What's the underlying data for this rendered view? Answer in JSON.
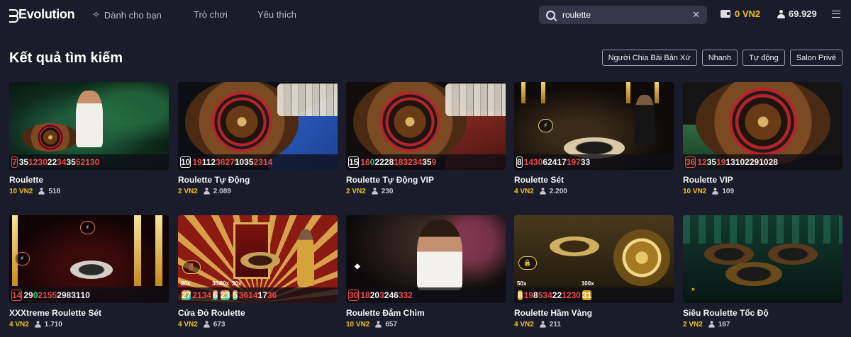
{
  "header": {
    "brand": "Evolution",
    "nav": [
      {
        "label": "Dành cho bạn"
      },
      {
        "label": "Trò chơi"
      },
      {
        "label": "Yêu thích"
      }
    ],
    "search": {
      "value": "roulette",
      "placeholder": ""
    },
    "balance": "0 VN2",
    "players": "69.929"
  },
  "page": {
    "title": "Kết quả tìm kiếm",
    "filters": [
      "Người Chia Bài Bản Xứ",
      "Nhanh",
      "Tự động",
      "Salon Privé"
    ]
  },
  "colors": {
    "accent": "#f2c21d",
    "red": "#f04848",
    "green": "#2fc86a",
    "background": "#1b1c2b"
  },
  "games": [
    {
      "name": "Roulette",
      "stake": "10 VN2",
      "players": "518",
      "results": [
        {
          "v": "7",
          "c": "red"
        },
        {
          "v": "35",
          "c": "black"
        },
        {
          "v": "12",
          "c": "red"
        },
        {
          "v": "30",
          "c": "red"
        },
        {
          "v": "22",
          "c": "black"
        },
        {
          "v": "34",
          "c": "red"
        },
        {
          "v": "35",
          "c": "black"
        },
        {
          "v": "5",
          "c": "red"
        },
        {
          "v": "21",
          "c": "red"
        },
        {
          "v": "30",
          "c": "red"
        }
      ]
    },
    {
      "name": "Roulette Tự Động",
      "stake": "2 VN2",
      "players": "2.089",
      "results": [
        {
          "v": "10",
          "c": "black"
        },
        {
          "v": "19",
          "c": "red"
        },
        {
          "v": "11",
          "c": "black"
        },
        {
          "v": "2",
          "c": "black"
        },
        {
          "v": "36",
          "c": "red"
        },
        {
          "v": "27",
          "c": "red"
        },
        {
          "v": "10",
          "c": "black"
        },
        {
          "v": "35",
          "c": "black"
        },
        {
          "v": "23",
          "c": "red"
        },
        {
          "v": "14",
          "c": "red"
        }
      ]
    },
    {
      "name": "Roulette Tự Động VIP",
      "stake": "2 VN2",
      "players": "230",
      "results": [
        {
          "v": "15",
          "c": "black"
        },
        {
          "v": "16",
          "c": "red"
        },
        {
          "v": "0",
          "c": "green"
        },
        {
          "v": "22",
          "c": "black"
        },
        {
          "v": "28",
          "c": "black"
        },
        {
          "v": "18",
          "c": "red"
        },
        {
          "v": "32",
          "c": "red"
        },
        {
          "v": "34",
          "c": "red"
        },
        {
          "v": "35",
          "c": "black"
        },
        {
          "v": "9",
          "c": "red"
        }
      ]
    },
    {
      "name": "Roulette Sét",
      "stake": "4 VN2",
      "players": "2.200",
      "results": [
        {
          "v": "8",
          "c": "black"
        },
        {
          "v": "14",
          "c": "red"
        },
        {
          "v": "30",
          "c": "red"
        },
        {
          "v": "6",
          "c": "black"
        },
        {
          "v": "24",
          "c": "black"
        },
        {
          "v": "17",
          "c": "black"
        },
        {
          "v": "19",
          "c": "red"
        },
        {
          "v": "7",
          "c": "red"
        },
        {
          "v": "33",
          "c": "black"
        }
      ]
    },
    {
      "name": "Roulette VIP",
      "stake": "10 VN2",
      "players": "109",
      "results": [
        {
          "v": "36",
          "c": "red"
        },
        {
          "v": "12",
          "c": "red"
        },
        {
          "v": "35",
          "c": "black"
        },
        {
          "v": "19",
          "c": "red"
        },
        {
          "v": "13",
          "c": "black"
        },
        {
          "v": "10",
          "c": "black"
        },
        {
          "v": "2",
          "c": "black"
        },
        {
          "v": "29",
          "c": "black"
        },
        {
          "v": "10",
          "c": "black"
        },
        {
          "v": "28",
          "c": "black"
        }
      ]
    },
    {
      "name": "XXXtreme Roulette Sét",
      "stake": "4 VN2",
      "players": "1.710",
      "results": [
        {
          "v": "14",
          "c": "red"
        },
        {
          "v": "29",
          "c": "black"
        },
        {
          "v": "0",
          "c": "green"
        },
        {
          "v": "21",
          "c": "red"
        },
        {
          "v": "5",
          "c": "red"
        },
        {
          "v": "5",
          "c": "red"
        },
        {
          "v": "29",
          "c": "black"
        },
        {
          "v": "8",
          "c": "black"
        },
        {
          "v": "31",
          "c": "black"
        },
        {
          "v": "10",
          "c": "black"
        }
      ]
    },
    {
      "name": "Cửa Đỏ Roulette",
      "stake": "4 VN2",
      "players": "673",
      "results": [
        {
          "v": "27",
          "c": "boxed",
          "tag": "20x"
        },
        {
          "v": "21",
          "c": "red"
        },
        {
          "v": "34",
          "c": "red"
        },
        {
          "v": "6",
          "c": "boxed",
          "tag": "30x"
        },
        {
          "v": "23",
          "c": "boxed",
          "tag": "30x"
        },
        {
          "v": "5",
          "c": "boxed",
          "tag": "30x"
        },
        {
          "v": "36",
          "c": "red"
        },
        {
          "v": "14",
          "c": "red"
        },
        {
          "v": "17",
          "c": "black"
        },
        {
          "v": "36",
          "c": "red"
        }
      ]
    },
    {
      "name": "Roulette Đắm Chìm",
      "stake": "10 VN2",
      "players": "657",
      "results": [
        {
          "v": "30",
          "c": "red"
        },
        {
          "v": "18",
          "c": "red"
        },
        {
          "v": "20",
          "c": "black"
        },
        {
          "v": "3",
          "c": "red"
        },
        {
          "v": "24",
          "c": "black"
        },
        {
          "v": "6",
          "c": "black"
        },
        {
          "v": "3",
          "c": "red"
        },
        {
          "v": "32",
          "c": "red"
        }
      ]
    },
    {
      "name": "Roulette Hầm Vàng",
      "stake": "4 VN2",
      "players": "211",
      "results": [
        {
          "v": "8",
          "c": "gold",
          "tag": "50x"
        },
        {
          "v": "19",
          "c": "red"
        },
        {
          "v": "8",
          "c": "black"
        },
        {
          "v": "5",
          "c": "red"
        },
        {
          "v": "34",
          "c": "red"
        },
        {
          "v": "22",
          "c": "black"
        },
        {
          "v": "12",
          "c": "red"
        },
        {
          "v": "30",
          "c": "red"
        },
        {
          "v": "31",
          "c": "gold",
          "tag": "100x"
        }
      ]
    },
    {
      "name": "Siêu Roulette Tốc Độ",
      "stake": "2 VN2",
      "players": "167",
      "results": []
    }
  ]
}
